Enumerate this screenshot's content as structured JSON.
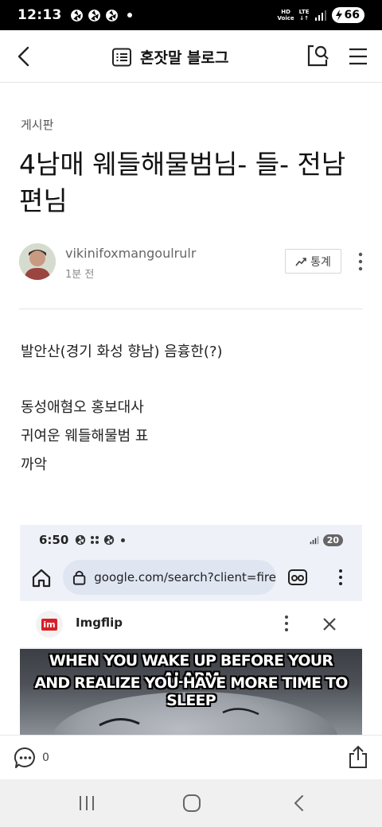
{
  "status_bar": {
    "time": "12:13",
    "battery": "66",
    "net_top": "HD",
    "net_bottom": "Voice",
    "lte_top": "LTE"
  },
  "header": {
    "title": "혼잣말 블로그",
    "back_icon": "chevron-left-icon",
    "list_icon": "list-icon",
    "search_icon": "search-icon",
    "menu_icon": "hamburger-icon"
  },
  "post": {
    "category": "게시판",
    "title": "4남매 웨들해물범님- 들- 전남편님",
    "author": "vikinifoxmangoulrulr",
    "time": "1분 전",
    "stats_label": "통계",
    "body_lines": [
      "발안산(경기 화성 향남) 음흉한(?)",
      "",
      "동성애혐오 홍보대사",
      "귀여운 웨들해물범 표",
      "까악"
    ]
  },
  "embed": {
    "time": "6:50",
    "battery": "20",
    "url": "google.com/search?client=fire",
    "site_name": "Imgflip",
    "favicon_text": "im",
    "meme_line1": "WHEN YOU WAKE UP BEFORE YOUR ALARM",
    "meme_line2": "AND REALIZE YOU HAVE MORE TIME TO SLEEP"
  },
  "actions": {
    "comment_count": "0"
  }
}
